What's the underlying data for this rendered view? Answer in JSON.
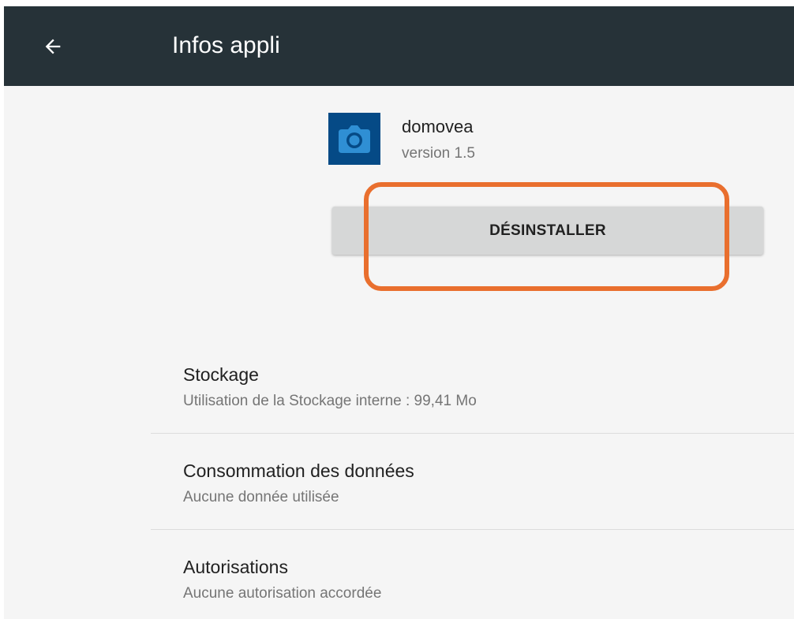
{
  "appbar": {
    "back_icon": "arrow-left-icon",
    "title": "Infos appli"
  },
  "app": {
    "icon": "camera-icon",
    "name": "domovea",
    "version": "version 1.5"
  },
  "actions": {
    "uninstall_label": "DÉSINSTALLER"
  },
  "colors": {
    "appbar": "#263238",
    "background": "#f5f5f5",
    "button": "#d6d7d7",
    "icon_bg": "#054a86",
    "icon_fg": "#2f8fd4",
    "highlight": "#e96f2e"
  },
  "settings": [
    {
      "title": "Stockage",
      "summary": "Utilisation de la Stockage interne : 99,41 Mo"
    },
    {
      "title": "Consommation des données",
      "summary": "Aucune donnée utilisée"
    },
    {
      "title": "Autorisations",
      "summary": "Aucune autorisation accordée"
    }
  ]
}
